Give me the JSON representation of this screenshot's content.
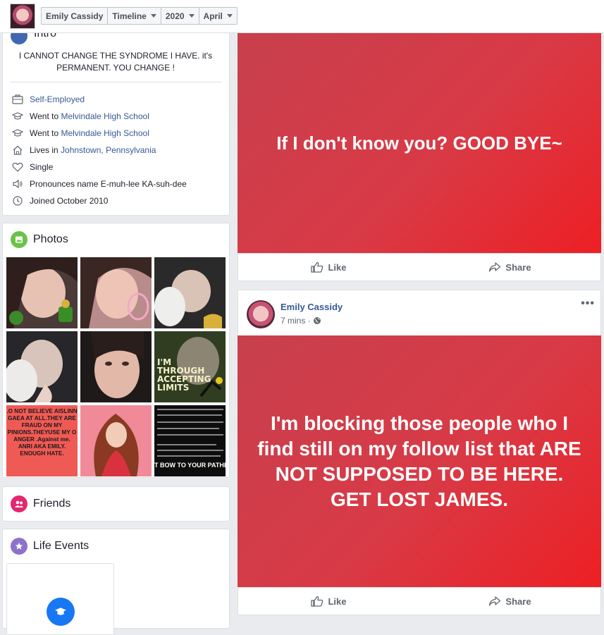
{
  "topbar": {
    "name": "Emily Cassidy",
    "crumbs": [
      "Timeline",
      "2020",
      "April"
    ]
  },
  "intro": {
    "title": "Intro",
    "bio": "I CANNOT CHANGE THE SYNDROME I HAVE. it's PERMANENT. YOU CHANGE !",
    "work": "Self-Employed",
    "school1_prefix": "Went to ",
    "school1": "Melvindale High School",
    "school2_prefix": "Went to ",
    "school2": "Melvindale High School",
    "lives_prefix": "Lives in ",
    "lives": "Johnstown, Pennsylvania",
    "relationship": "Single",
    "pronounce": "Pronounces name E-muh-lee KA-suh-dee",
    "joined": "Joined October 2010"
  },
  "photos": {
    "title": "Photos",
    "tile8_text": "I'M THROUGH ACCEPTING LIMITS",
    "tile7_lines": [
      ".O NOT BELIEVE AISLINN",
      "GAEA AT ALL.THEY ARE",
      "FRAUD ON MY",
      "PINIONS.THEYUSE MY O",
      "ANGER .Against me.",
      "ANRI AKA EMILY.",
      "ENOUGH HATE."
    ],
    "tile9_bottom": "T BOW TO YOUR PATHET"
  },
  "friends": {
    "title": "Friends"
  },
  "life_events": {
    "title": "Life Events"
  },
  "post1": {
    "text": "If I don't know you? GOOD BYE~",
    "like": "Like",
    "share": "Share"
  },
  "post2": {
    "author": "Emily Cassidy",
    "time": "7 mins ·",
    "text": "I'm blocking those people who I find still on my follow list that ARE NOT SUPPOSED TO BE HERE. GET LOST JAMES.",
    "like": "Like",
    "share": "Share"
  },
  "colors": {
    "link": "#385898",
    "post_bg_start": "#c8404d",
    "post_bg_end": "#ed1f24",
    "accent": "#4267b2"
  }
}
